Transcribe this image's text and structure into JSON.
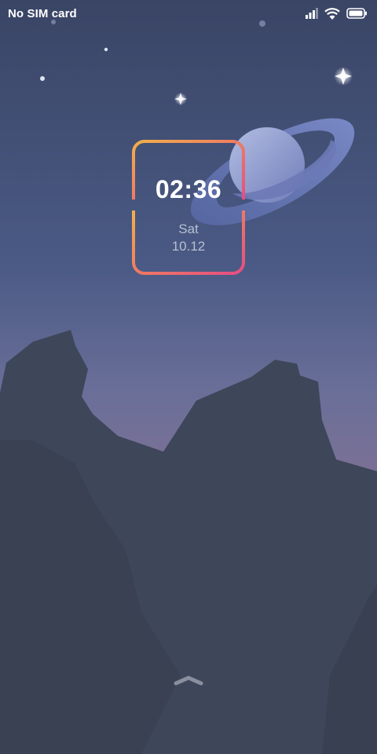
{
  "status_bar": {
    "carrier": "No SIM card",
    "icons": [
      "signal-icon",
      "wifi-icon",
      "battery-icon"
    ]
  },
  "lock_clock": {
    "time": "02:36",
    "day": "Sat",
    "date": "10.12"
  },
  "unlock_handle": {
    "icon": "chevron-up-icon"
  },
  "colors": {
    "sky_top": "#3c4867",
    "sky_bottom": "#75718f",
    "mountain": "#3b4354",
    "frame_gradient": [
      "#f3a94d",
      "#e8517b"
    ],
    "planet": "#8e9bcf"
  }
}
